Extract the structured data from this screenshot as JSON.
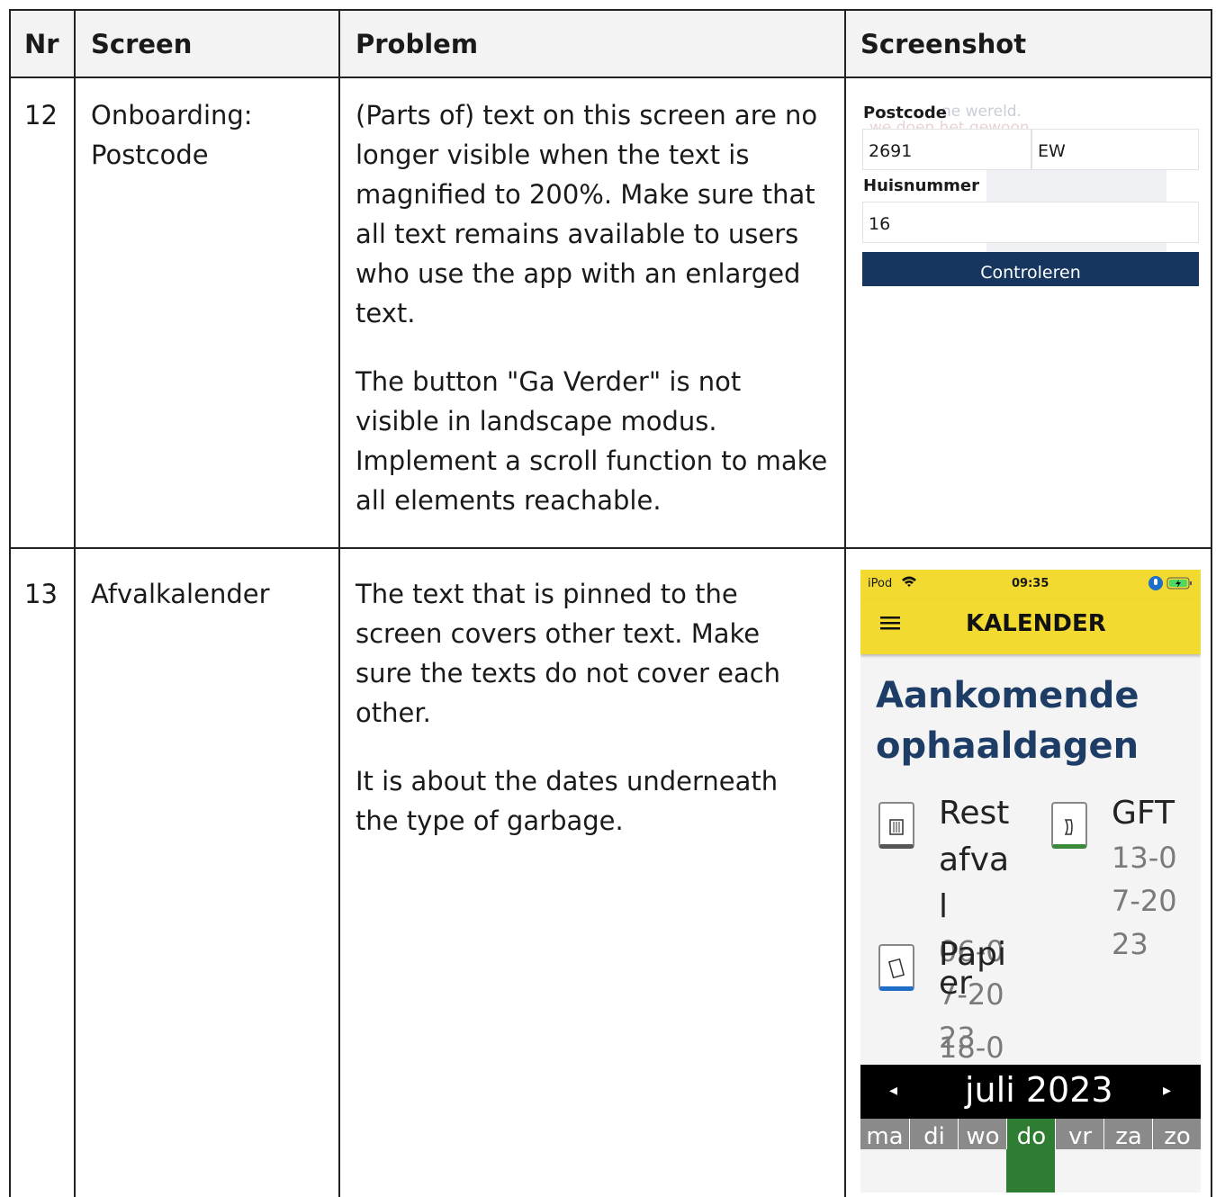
{
  "table": {
    "headers": {
      "nr": "Nr",
      "screen": "Screen",
      "problem": "Problem",
      "screenshot": "Screenshot"
    },
    "rows": [
      {
        "nr": "12",
        "screen": "Onboarding: Postcode",
        "problem": [
          "(Parts of) text on this screen are no longer visible when the text is magnified to 200%. Make sure that all text remains available to users who use the app with an enlarged text.",
          "The button \"Ga Verder\" is not visible in landscape modus. Implement a scroll function to make all elements reachable."
        ]
      },
      {
        "nr": "13",
        "screen": "Afvalkalender",
        "problem": [
          "The text that is pinned to the screen covers other text. Make sure the texts do not cover each other.",
          "It is about the dates underneath the type of garbage."
        ]
      }
    ]
  },
  "shot1": {
    "ghost_text_1": "ne wereld.",
    "ghost_text_2": "we doen het gewoon",
    "postcode_label": "Postcode",
    "postcode_digits": "2691",
    "postcode_letters": "EW",
    "huisnummer_label": "Huisnummer",
    "huisnummer_value": "16",
    "button_label": "Controleren"
  },
  "shot2": {
    "status": {
      "device": "iPod",
      "time": "09:35"
    },
    "header_title": "KALENDER",
    "menu_icon": "hamburger-icon",
    "heading_line1": "Aankomende",
    "heading_line2": "ophaaldagen",
    "items": {
      "rest": {
        "name_lines": [
          "Rest",
          "afva",
          "l"
        ],
        "date_lines": [
          "06-0",
          "7-20",
          "23"
        ],
        "icon_label": "Rest"
      },
      "gft": {
        "name": "GFT",
        "date_lines": [
          "13-0",
          "7-20",
          "23"
        ],
        "icon_label": "GFT en Etensresten"
      },
      "papier": {
        "name_lines": [
          "Papi",
          "er"
        ],
        "date_line": "18-0",
        "icon_label": "Papier"
      }
    },
    "calendar": {
      "month": "juli 2023",
      "days": [
        "ma",
        "di",
        "wo",
        "do",
        "vr",
        "za",
        "zo"
      ],
      "highlight_color": "#2e7d32"
    },
    "colors": {
      "yellow": "#f2da31",
      "navy": "#1e3d66",
      "green": "#3a8a3a",
      "blue": "#1f6fc9"
    }
  }
}
